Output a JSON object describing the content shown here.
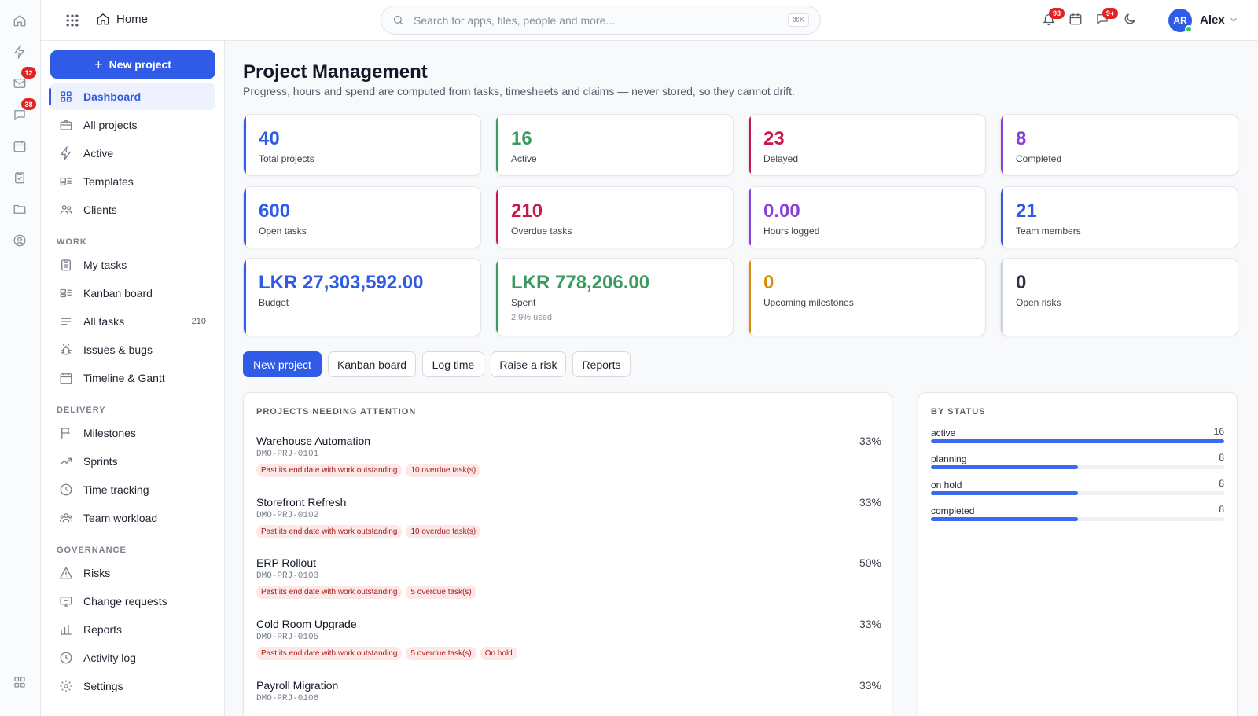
{
  "rail": {
    "mail_badge": "12",
    "chat_badge": "38"
  },
  "topbar": {
    "home_label": "Home",
    "search_placeholder": "Search for apps, files, people and more...",
    "search_shortcut": "⌘K",
    "notifications_badge": "93",
    "messages_badge": "9+",
    "avatar_initials": "AR",
    "user_name": "Alex"
  },
  "sidebar": {
    "new_project_label": "New project",
    "items": [
      {
        "label": "Dashboard",
        "icon": "dashboard-icon",
        "active": true
      },
      {
        "label": "All projects",
        "icon": "briefcase-icon"
      },
      {
        "label": "Active",
        "icon": "bolt-icon"
      },
      {
        "label": "Templates",
        "icon": "template-icon"
      },
      {
        "label": "Clients",
        "icon": "users-icon"
      }
    ],
    "work_section": "WORK",
    "work_items": [
      {
        "label": "My tasks",
        "icon": "clipboard-icon"
      },
      {
        "label": "Kanban board",
        "icon": "kanban-icon"
      },
      {
        "label": "All tasks",
        "icon": "list-icon",
        "count": "210"
      },
      {
        "label": "Issues & bugs",
        "icon": "bug-icon"
      },
      {
        "label": "Timeline & Gantt",
        "icon": "calendar-icon"
      }
    ],
    "delivery_section": "DELIVERY",
    "delivery_items": [
      {
        "label": "Milestones",
        "icon": "flag-icon"
      },
      {
        "label": "Sprints",
        "icon": "trend-icon"
      },
      {
        "label": "Time tracking",
        "icon": "clock-icon"
      },
      {
        "label": "Team workload",
        "icon": "team-icon"
      }
    ],
    "governance_section": "GOVERNANCE",
    "governance_items": [
      {
        "label": "Risks",
        "icon": "warning-icon"
      },
      {
        "label": "Change requests",
        "icon": "change-icon"
      },
      {
        "label": "Reports",
        "icon": "bar-chart-icon"
      },
      {
        "label": "Activity log",
        "icon": "history-icon"
      },
      {
        "label": "Settings",
        "icon": "gear-icon"
      }
    ]
  },
  "header": {
    "title": "Project Management",
    "subtitle": "Progress, hours and spend are computed from tasks, timesheets and claims — never stored, so they cannot drift."
  },
  "stats": [
    {
      "value": "40",
      "label": "Total projects",
      "color": "#2f5be7"
    },
    {
      "value": "16",
      "label": "Active",
      "color": "#3a9a60"
    },
    {
      "value": "23",
      "label": "Delayed",
      "color": "#c8194b"
    },
    {
      "value": "8",
      "label": "Completed",
      "color": "#8b3fd9"
    },
    {
      "value": "600",
      "label": "Open tasks",
      "color": "#2f5be7"
    },
    {
      "value": "210",
      "label": "Overdue tasks",
      "color": "#c8194b"
    },
    {
      "value": "0.00",
      "label": "Hours logged",
      "color": "#8b3fd9"
    },
    {
      "value": "21",
      "label": "Team members",
      "color": "#2f5be7"
    },
    {
      "value": "LKR 27,303,592.00",
      "label": "Budget",
      "color": "#2f5be7"
    },
    {
      "value": "LKR 778,206.00",
      "label": "Spent",
      "note": "2.9% used",
      "color": "#3a9a60"
    },
    {
      "value": "0",
      "label": "Upcoming milestones",
      "color": "#d98b0b"
    },
    {
      "value": "0",
      "label": "Open risks",
      "color": "#2e3440"
    }
  ],
  "actions": [
    "New project",
    "Kanban board",
    "Log time",
    "Raise a risk",
    "Reports"
  ],
  "attention": {
    "title": "PROJECTS NEEDING ATTENTION",
    "projects": [
      {
        "name": "Warehouse Automation",
        "code": "DMO-PRJ-0101",
        "percent": "33%",
        "tags": [
          "Past its end date with work outstanding",
          "10 overdue task(s)"
        ]
      },
      {
        "name": "Storefront Refresh",
        "code": "DMO-PRJ-0102",
        "percent": "33%",
        "tags": [
          "Past its end date with work outstanding",
          "10 overdue task(s)"
        ]
      },
      {
        "name": "ERP Rollout",
        "code": "DMO-PRJ-0103",
        "percent": "50%",
        "tags": [
          "Past its end date with work outstanding",
          "5 overdue task(s)"
        ]
      },
      {
        "name": "Cold Room Upgrade",
        "code": "DMO-PRJ-0105",
        "percent": "33%",
        "tags": [
          "Past its end date with work outstanding",
          "5 overdue task(s)",
          "On hold"
        ]
      },
      {
        "name": "Payroll Migration",
        "code": "DMO-PRJ-0106",
        "percent": "33%",
        "tags": []
      }
    ]
  },
  "by_status": {
    "title": "BY STATUS",
    "rows": [
      {
        "label": "active",
        "count": "16",
        "fraction": 1.0
      },
      {
        "label": "planning",
        "count": "8",
        "fraction": 0.5
      },
      {
        "label": "on hold",
        "count": "8",
        "fraction": 0.5
      },
      {
        "label": "completed",
        "count": "8",
        "fraction": 0.5
      }
    ]
  }
}
